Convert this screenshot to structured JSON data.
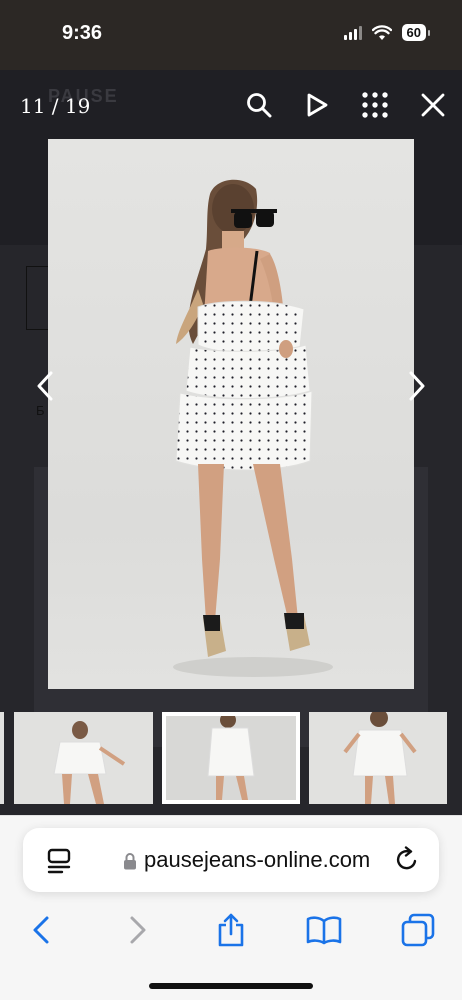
{
  "status_bar": {
    "time": "9:36",
    "battery": "60"
  },
  "lightbox": {
    "counter": "11 / 19",
    "icons": [
      "search-icon",
      "play-icon",
      "grid-icon",
      "close-icon"
    ],
    "nav": [
      "chevron-left-icon",
      "chevron-right-icon"
    ],
    "main_image": "photo-woman-white-polka-dot-tiered-ruffle-dress-back-view"
  },
  "background_site": {
    "logo": "PAUSE",
    "text_fragment": "Б"
  },
  "thumbnails": [
    {
      "image": "photo-dress-side-view",
      "selected": false
    },
    {
      "image": "photo-dress-back-view",
      "selected": true
    },
    {
      "image": "photo-dress-front-view",
      "selected": false
    }
  ],
  "browser": {
    "url": "pausejeans-online.com",
    "toolbar_icons": [
      "back-icon",
      "forward-icon",
      "share-icon",
      "bookmarks-icon",
      "tabs-icon"
    ]
  },
  "colors": {
    "lightbox_bg": "#26262b",
    "status_bg": "#2c2825",
    "accent": "#1a73e8"
  }
}
